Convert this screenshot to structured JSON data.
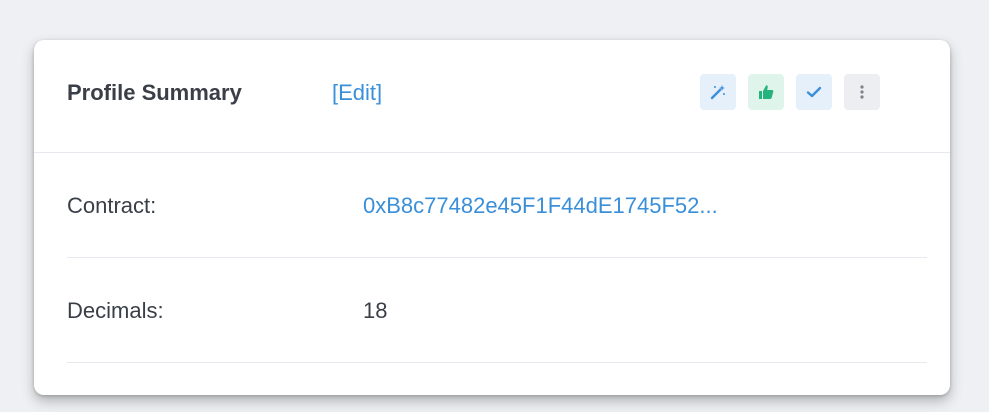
{
  "card": {
    "title": "Profile Summary",
    "edit_label": "[Edit]",
    "actions": [
      {
        "icon": "magic-wand-icon",
        "color": "#3a8fd9"
      },
      {
        "icon": "thumbs-up-icon",
        "color": "#27b47c"
      },
      {
        "icon": "check-icon",
        "color": "#3a8fd9"
      },
      {
        "icon": "more-vertical-icon",
        "color": "#7d838c"
      }
    ]
  },
  "rows": [
    {
      "label": "Contract:",
      "value": "0xB8c77482e45F1F44dE1745F52..."
    },
    {
      "label": "Decimals:",
      "value": "18"
    }
  ],
  "colors": {
    "link": "#3a8fd9",
    "text": "#3a3f47",
    "background": "#eef0f3"
  }
}
